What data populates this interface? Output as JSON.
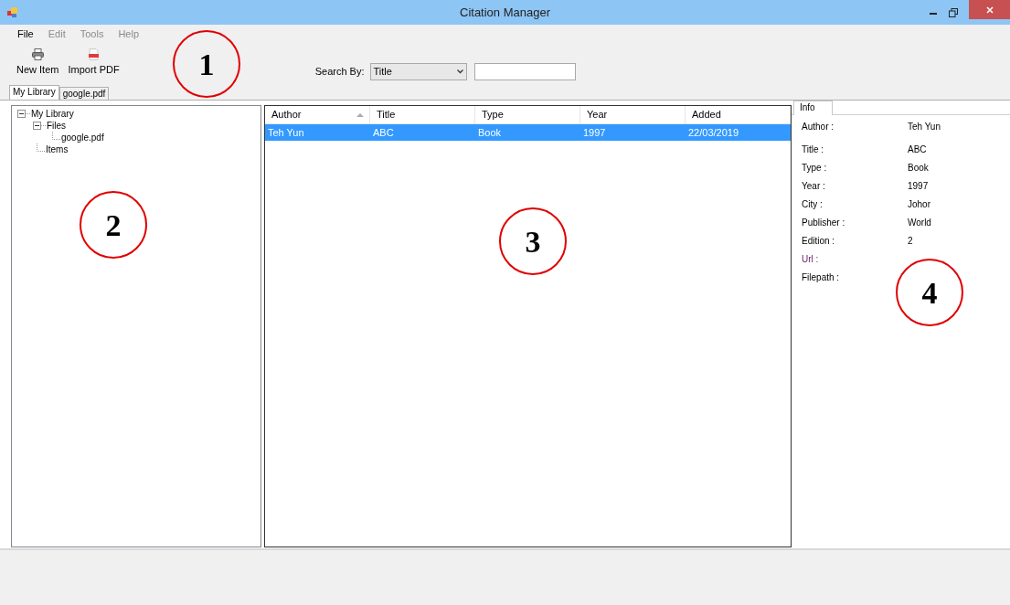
{
  "window": {
    "title": "Citation Manager"
  },
  "menu": [
    {
      "label": "File",
      "disabled": false
    },
    {
      "label": "Edit",
      "disabled": true
    },
    {
      "label": "Tools",
      "disabled": true
    },
    {
      "label": "Help",
      "disabled": true
    }
  ],
  "toolbar": [
    {
      "label": "New Item",
      "kind": "new"
    },
    {
      "label": "Import PDF",
      "kind": "pdf"
    }
  ],
  "search": {
    "label": "Search By:",
    "field": "Title"
  },
  "tabs": [
    {
      "label": "My Library",
      "selected": true
    },
    {
      "label": "google.pdf",
      "selected": false
    }
  ],
  "tree": [
    {
      "label": "My Library",
      "expanded": true,
      "children": [
        {
          "label": "Files",
          "expanded": true,
          "children": [
            {
              "label": "google.pdf"
            }
          ]
        },
        {
          "label": "Items"
        }
      ]
    }
  ],
  "table": {
    "columns": [
      {
        "label": "Author",
        "sorted": true
      },
      {
        "label": "Title",
        "sorted": false
      },
      {
        "label": "Type",
        "sorted": false
      },
      {
        "label": "Year",
        "sorted": false
      },
      {
        "label": "Added",
        "sorted": false
      }
    ],
    "rows": [
      {
        "cells": [
          "Teh Yun",
          "ABC",
          "Book",
          "1997",
          "22/03/2019"
        ],
        "selected": true
      }
    ]
  },
  "info": {
    "tab": "Info",
    "fields": [
      {
        "label": "Author :",
        "value": "Teh Yun"
      },
      {
        "label": "Title :",
        "value": "ABC"
      },
      {
        "label": "Type :",
        "value": "Book"
      },
      {
        "label": "Year :",
        "value": "1997"
      },
      {
        "label": "City :",
        "value": "Johor"
      },
      {
        "label": "Publisher :",
        "value": "World"
      },
      {
        "label": "Edition :",
        "value": "2"
      },
      {
        "label": "Url :",
        "kind": "link"
      },
      {
        "label": "Filepath :"
      }
    ]
  },
  "annotations": [
    "1",
    "2",
    "3",
    "4"
  ]
}
